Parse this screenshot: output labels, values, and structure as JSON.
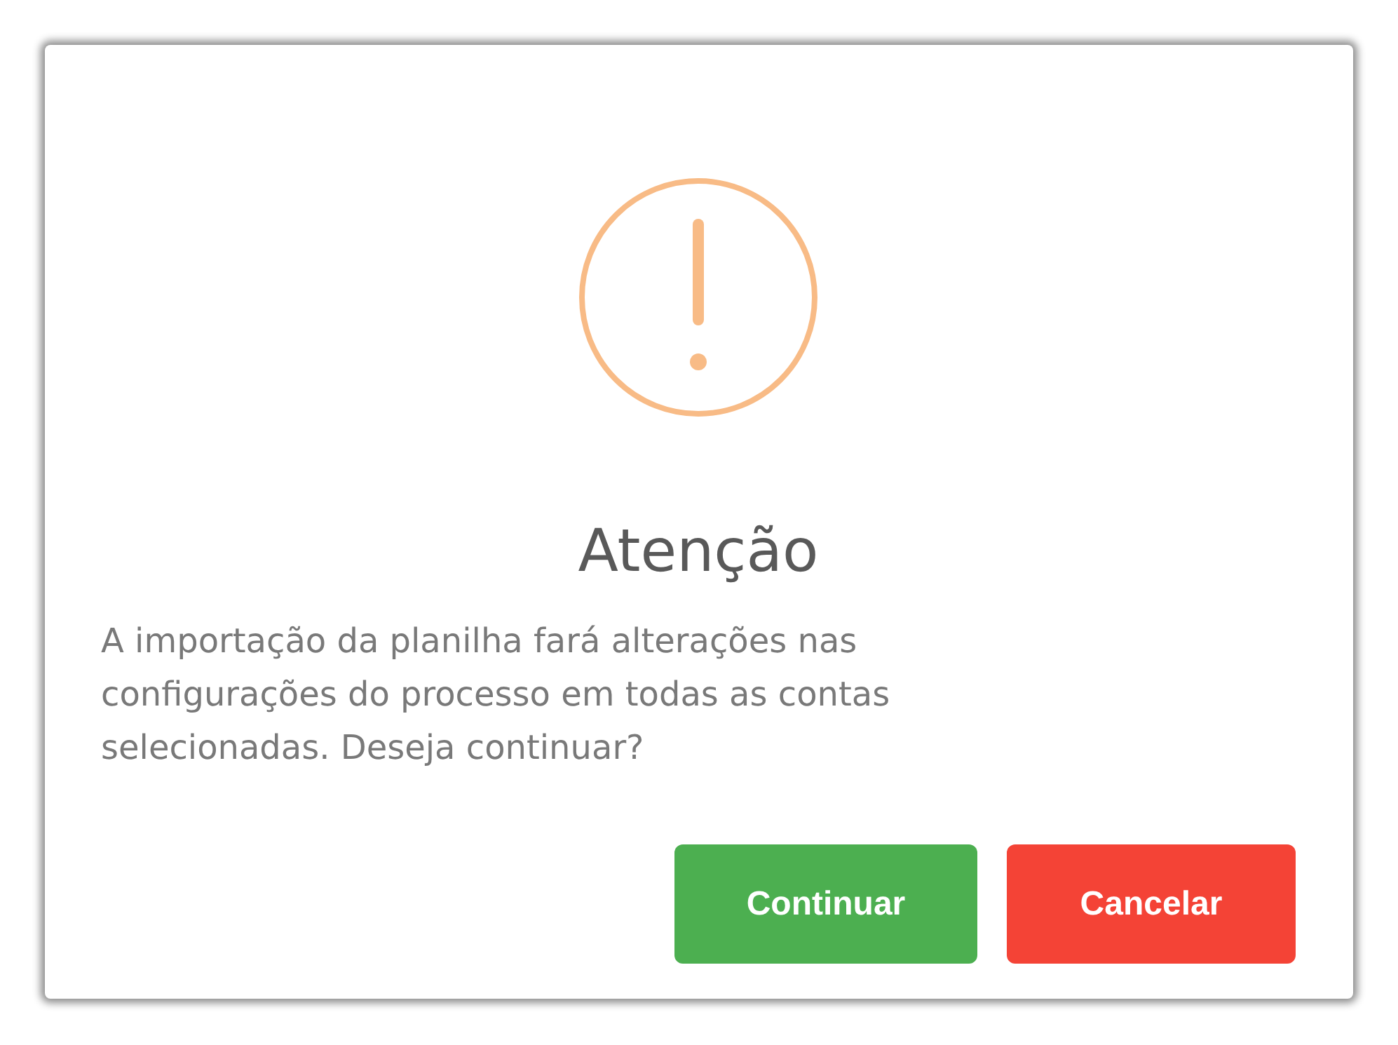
{
  "dialog": {
    "title": "Atenção",
    "message": "A importação da planilha fará alterações nas configurações do processo em todas as contas selecionadas. Deseja continuar?",
    "buttons": [
      {
        "label": "Continuar",
        "kind": "confirm"
      },
      {
        "label": "Cancelar",
        "kind": "cancel"
      }
    ]
  }
}
